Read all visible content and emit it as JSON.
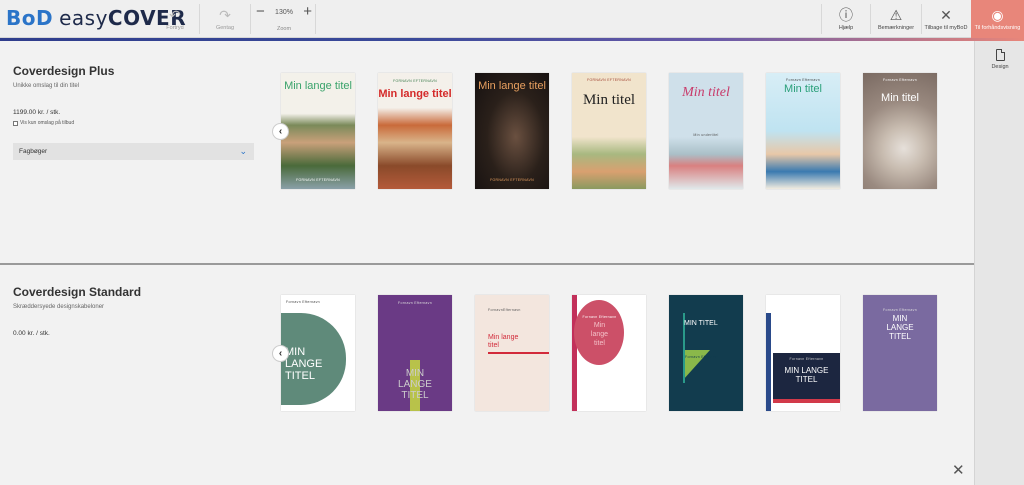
{
  "app": {
    "logo_bod": "BoD",
    "logo_easy": "easy",
    "logo_cover": "COVER"
  },
  "toolbar": {
    "undo": "Fortryd",
    "redo": "Gentag",
    "zoom_value": "130%",
    "zoom_label": "Zoom",
    "help": "Hjælp",
    "remarks": "Bemærkninger",
    "back": "Tilbage til myBoD",
    "preview": "Til forhåndsvisning"
  },
  "right_panel": {
    "design_label": "Design"
  },
  "plus": {
    "title": "Coverdesign Plus",
    "subtitle": "Unikke omslag til din titel",
    "price": "1199.00 kr. / stk.",
    "checkbox_label": "Vis kun omslag på tilbud",
    "category": "Fagbøger",
    "covers": [
      {
        "title": "Min lange titel",
        "author": "FORNAVN EFTERNAVN"
      },
      {
        "title": "Min lange titel",
        "author": "FORNAVN EFTERNAVN"
      },
      {
        "title": "Min lange titel",
        "author": "FORNAVN EFTERNAVN"
      },
      {
        "title": "Min titel",
        "author": "FORNAVN EFTERNAVN"
      },
      {
        "title": "Min titel",
        "author": "Min undertitel"
      },
      {
        "title": "Min titel",
        "author": "Fornavn Efternavn"
      },
      {
        "title": "Min titel",
        "author": "Fornavn Efternavn"
      }
    ]
  },
  "standard": {
    "title": "Coverdesign Standard",
    "subtitle": "Skræddersyede designskabeloner",
    "price": "0.00 kr. / stk.",
    "covers": [
      {
        "title": "MIN LANGE TITEL",
        "author": "Fornavn Efternavn"
      },
      {
        "title": "MIN LANGE TITEL",
        "author": "Fornavn Efternavn"
      },
      {
        "title": "Min lange titel",
        "author": "FornavnEfternavn"
      },
      {
        "title": "Min lange titel",
        "author": "Fornavn Efternavn"
      },
      {
        "title": "MIN TITEL",
        "author": "Fornavn Efternavn"
      },
      {
        "title": "MIN LANGE TITEL",
        "author": "Fornavn Efternavn"
      },
      {
        "title": "MIN LANGE TITEL",
        "author": "Fornavn Efternavn"
      }
    ]
  },
  "colors": {
    "accent": "#2b74c8",
    "preview_bg": "#e8867a"
  }
}
